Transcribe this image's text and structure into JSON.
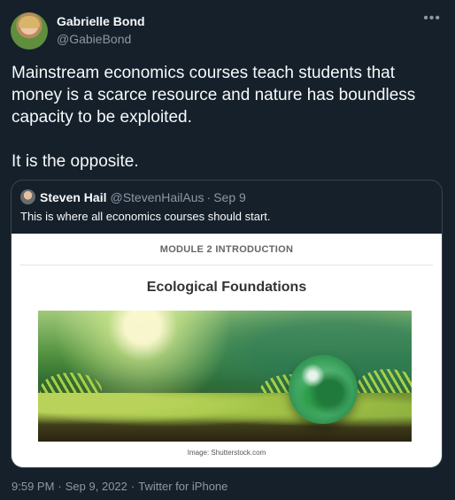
{
  "author": {
    "display_name": "Gabrielle Bond",
    "handle": "@GabieBond"
  },
  "more_icon": "more-horizontal-icon",
  "tweet": {
    "paragraphs": [
      "Mainstream economics courses teach students that money is a scarce resource and nature has boundless capacity to be exploited.",
      "It is the opposite."
    ]
  },
  "quote": {
    "display_name": "Steven Hail",
    "handle": "@StevenHailAus",
    "separator": "·",
    "date": "Sep 9",
    "text": "This is where all economics courses should start.",
    "card": {
      "module": "MODULE 2 INTRODUCTION",
      "title": "Ecological Foundations",
      "caption": "Image: Shutterstock.com"
    }
  },
  "meta": {
    "time": "9:59 PM",
    "date": "Sep 9, 2022",
    "source": "Twitter for iPhone",
    "separator": "·"
  },
  "colors": {
    "background": "#15202b",
    "text": "#f7f9f9",
    "secondary": "#8b98a5",
    "border": "#38444d"
  }
}
